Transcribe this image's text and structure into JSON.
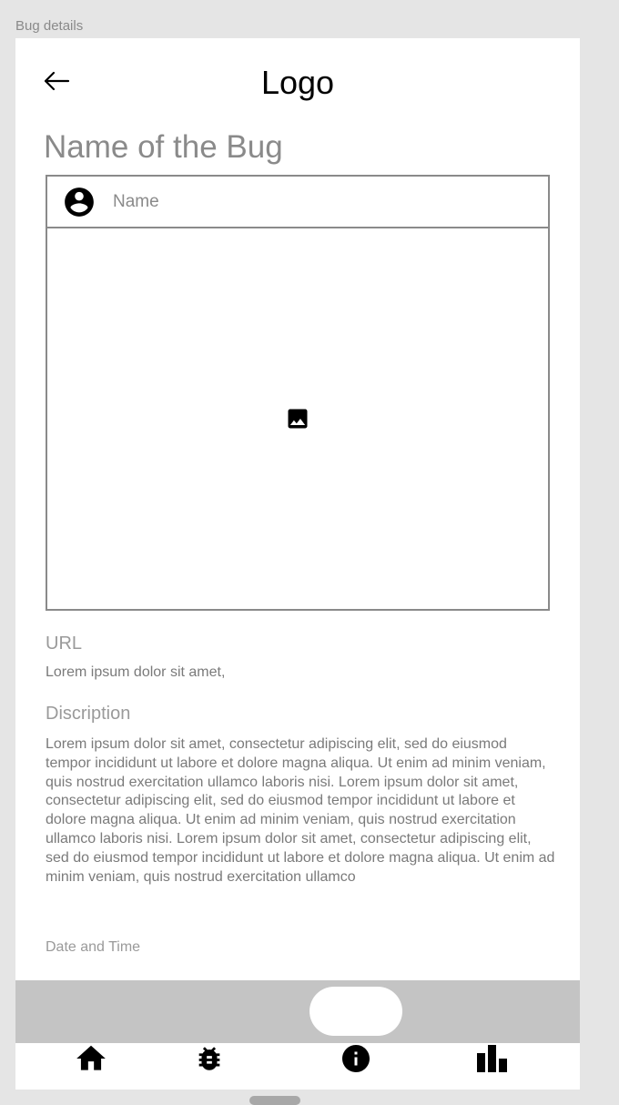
{
  "frame_label": "Bug details",
  "header": {
    "back_icon": "arrow-left-icon",
    "logo": "Logo"
  },
  "bug": {
    "title": "Name of the Bug",
    "reporter": {
      "avatar_icon": "account-circle-icon",
      "name": "Name"
    },
    "image_icon": "image-icon",
    "url_label": "URL",
    "url_value": "Lorem ipsum dolor sit amet,",
    "description_label": "Discription",
    "description": "Lorem ipsum dolor sit amet, consectetur adipiscing elit, sed do eiusmod tempor incididunt ut labore et dolore magna aliqua. Ut enim ad minim veniam, quis nostrud exercitation ullamco laboris nisi. Lorem ipsum dolor sit amet, consectetur adipiscing elit, sed do eiusmod tempor incididunt ut labore et dolore magna aliqua. Ut enim ad minim veniam, quis nostrud exercitation ullamco laboris nisi. Lorem ipsum dolor sit amet, consectetur adipiscing elit, sed do eiusmod tempor incididunt ut labore et dolore magna aliqua. Ut enim ad minim veniam, quis nostrud exercitation ullamco",
    "date_time_label": "Date and Time"
  },
  "nav": {
    "items": [
      {
        "icon": "home-icon"
      },
      {
        "icon": "bug-icon"
      },
      {
        "icon": "info-icon"
      },
      {
        "icon": "bar-chart-icon"
      }
    ]
  },
  "colors": {
    "background": "#e5e5e5",
    "surface": "#ffffff",
    "muted_text": "#8a8a8a",
    "sheet": "#c4c4c4"
  }
}
